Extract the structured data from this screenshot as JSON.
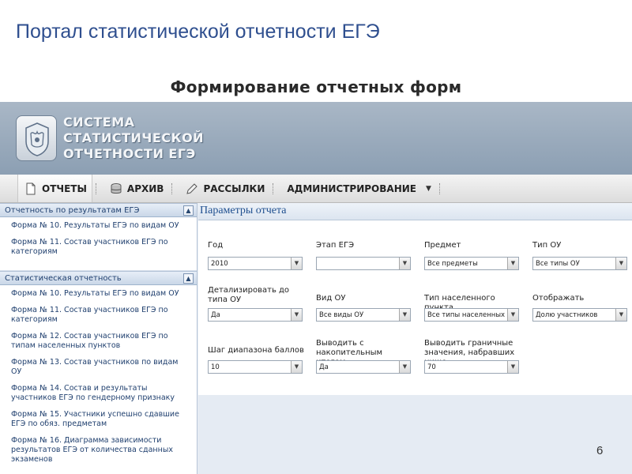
{
  "slide": {
    "title": "Портал статистической отчетности ЕГЭ",
    "subtitle": "Формирование отчетных форм",
    "page_number": "6"
  },
  "banner": {
    "logo_line1": "СИСТЕМА",
    "logo_line2": "СТАТИСТИЧЕСКОЙ",
    "logo_line3": "ОТЧЕТНОСТИ ЕГЭ"
  },
  "menu": {
    "reports": "ОТЧЕТЫ",
    "archive": "АРХИВ",
    "mailings": "РАССЫЛКИ",
    "admin": "АДМИНИСТРИРОВАНИЕ"
  },
  "sidebar": {
    "section1_title": "Отчетность по результатам ЕГЭ",
    "section1_items": [
      "Форма № 10. Результаты ЕГЭ по видам ОУ",
      "Форма № 11. Состав участников ЕГЭ по категориям"
    ],
    "section2_title": "Статистическая отчетность",
    "section2_items": [
      "Форма № 10. Результаты ЕГЭ по видам ОУ",
      "Форма № 11. Состав участников ЕГЭ по категориям",
      "Форма № 12. Состав участников ЕГЭ по типам населенных пунктов",
      "Форма № 13. Состав участников по видам ОУ",
      "Форма № 14. Состав и результаты участников ЕГЭ по гендерному признаку",
      "Форма № 15. Участники успешно сдавшие ЕГЭ по обяз. предметам",
      "Форма № 16. Диаграмма зависимости результатов ЕГЭ от количества сданных экзаменов"
    ]
  },
  "params": {
    "title": "Параметры отчета",
    "year": {
      "label": "Год",
      "value": "2010"
    },
    "stage": {
      "label": "Этап ЕГЭ",
      "value": ""
    },
    "subject": {
      "label": "Предмет",
      "value": "Все предметы"
    },
    "ou_type": {
      "label": "Тип ОУ",
      "value": "Все типы ОУ"
    },
    "detail": {
      "label": "Детализировать до типа ОУ",
      "value": "Да"
    },
    "ou_kind": {
      "label": "Вид ОУ",
      "value": "Все виды ОУ"
    },
    "settlement": {
      "label": "Тип населенного пункта",
      "value": "Все типы населенных пун"
    },
    "display": {
      "label": "Отображать",
      "value": "Долю участников"
    },
    "score_step": {
      "label": "Шаг диапазона баллов",
      "value": "10"
    },
    "cumulative": {
      "label": "Выводить с накопительным итогом",
      "value": "Да"
    },
    "boundary": {
      "label": "Выводить граничные значения, набравших ниже",
      "value": "70"
    }
  }
}
